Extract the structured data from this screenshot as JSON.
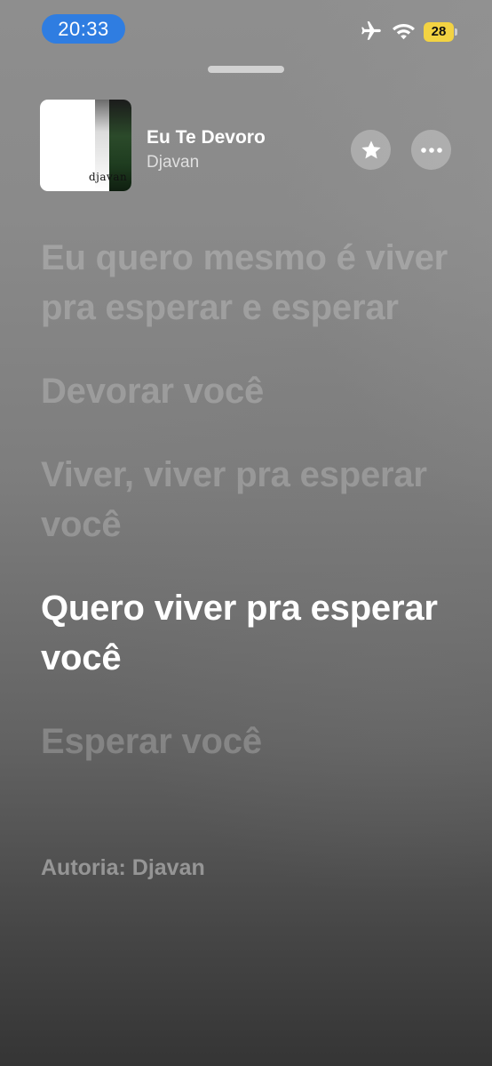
{
  "status_bar": {
    "time": "20:33",
    "battery_level": "28",
    "icons": [
      "airplane-icon",
      "wifi-icon",
      "battery-icon"
    ],
    "time_pill_color": "#2f7de1",
    "battery_color": "#f3d342"
  },
  "now_playing": {
    "title": "Eu Te Devoro",
    "artist": "Djavan",
    "album_logo": "djavan",
    "favorite_icon": "star-icon",
    "more_icon": "ellipsis-icon"
  },
  "lyrics": {
    "lines": [
      {
        "text": "Eu quero mesmo é viver pra esperar e esperar",
        "active": false
      },
      {
        "text": "Devorar você",
        "active": false
      },
      {
        "text": "Viver, viver pra esperar você",
        "active": false
      },
      {
        "text": "Quero viver pra esperar você",
        "active": true
      },
      {
        "text": "Esperar você",
        "active": false
      }
    ],
    "credits": "Autoria: Djavan"
  }
}
